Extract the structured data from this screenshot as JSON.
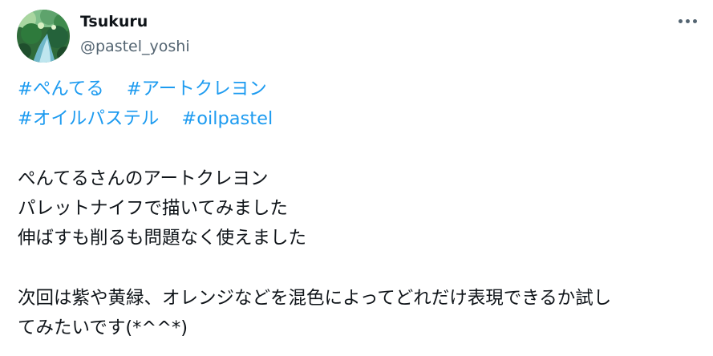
{
  "tweet": {
    "author": {
      "name": "Tsukuru",
      "handle": "@pastel_yoshi"
    },
    "hashtags": [
      "#ぺんてる",
      "#アートクレヨン",
      "#オイルパステル",
      "#oilpastel"
    ],
    "body_lines": [
      "ぺんてるさんのアートクレヨン",
      "パレットナイフで描いてみました",
      "伸ばすも削るも問題なく使えました",
      "次回は紫や黄緑、オレンジなどを混色によってどれだけ表現できるか試し",
      "てみたいです(*^^*)"
    ]
  },
  "colors": {
    "hashtag": "#1d9bf0",
    "text": "#0f1419",
    "secondary": "#536471"
  },
  "icons": {
    "more": "more-horizontal-icon"
  }
}
